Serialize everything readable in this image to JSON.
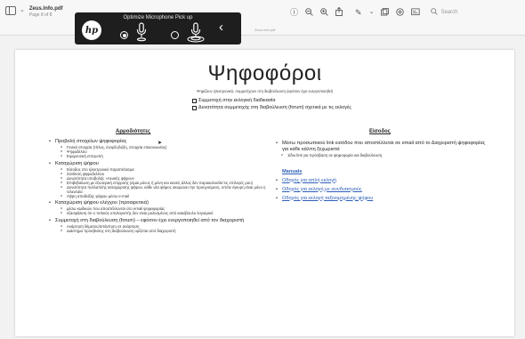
{
  "toolbar": {
    "doc_title": "Zeus.Info.pdf",
    "page_indicator": "Page 8 of 8",
    "search_placeholder": "Search"
  },
  "hp_overlay": {
    "title": "Optimize Microphone Pick up",
    "logo": "hp",
    "hidden_label": "Zeus.Info.pdf"
  },
  "icons": {
    "sidebar": "sidebar-toggle-icon",
    "info": "info-icon",
    "zoom_out": "zoom-out-icon",
    "zoom_in": "zoom-in-icon",
    "share": "share-icon",
    "markup": "markup-icon",
    "window": "window-icon",
    "annotate": "annotate-icon",
    "form": "form-icon",
    "search": "search-icon"
  },
  "page": {
    "title": "Ψηφοφόροι",
    "subtitle": "Ψηφίζουν ηλεκτρονικά, συμμετέχουν στη διαβούλευση (εφόσον έχει ενεργοποιηθεί)",
    "options": [
      "Συμμετοχή στην εκλογική διαδικασία",
      "Δυνατότητα συμμετοχής στη διαβούλευση (forum) σχετικά με τις εκλογές"
    ],
    "left_heading": "Αρμοδιότητες",
    "left_items": [
      {
        "text": "Προβολή στοιχείων ψηφοφορίας",
        "subs": [
          "Γενικά στοιχεία (τίτλος, έναρξη/λήξη, στοιχεία επικοινωνίας)",
          "Ψηφοδέλτιο",
          "Εφορευτική επιτροπή"
        ]
      },
      {
        "text": "Καταχώριση ψήφου",
        "subs": [
          "Είσοδος στο ηλεκτρονικό παραπέτασμα",
          "Σύνθεση ψηφοδελτίου",
          "Δυνατότητα υποβολής «Λευκής ψήφου»",
          "Επιβεβαίωση με εξωτερική επιρροής (είμαι μόνος ή μόνη και κανείς άλλος δεν παρακολουθεί τις επιλογές μου)",
          "Δυνατότητα πολλαπλής καταχώρισης ψήφου, κάθε νέα ψήφος ακυρώνει την προηγούμενη, οπότε έγκυρη είναι μόνο η τελευταία",
          "Λήψη αποδείξης ψήφου μέσω e-mail"
        ]
      },
      {
        "text": "Καταχώριση ψήφου ελέγχου (προαιρετικά)",
        "subs": [
          "μέσω κωδικών που αποστέλλονται στο email ψηφοφορίας",
          "εξασφάλιση ότι ο τοπικός υπολογιστής δεν είναι μολυσμένος από κακόβουλο λογισμικό"
        ]
      },
      {
        "text": "Συμμετοχή στη διαβούλευση (forum) – εφόσον έχει ενεργοποιηθεί από τον διαχειριστή",
        "subs": [
          "Ανάρτηση θέματος/απάντηση σε ανάρτηση",
          "Διάστημα πρόσβασης στη διαβούλευση ορίζεται από διαχειριστή"
        ]
      }
    ],
    "right_heading": "Είσοδος",
    "right_item": "Μέσω προσωπικού link εισόδου που αποστέλλεται σε email από το Διαχειριστή ψηφοφορίας για κάθε κάλπη ξεχωριστά",
    "right_sub": "1ίδιο link για πρόσβαση σε ψηφοφορία και διαβούλευση",
    "manuals_heading": "Manuals",
    "manual_links": [
      "Οδηγός για απλή εκλογή",
      "Οδηγός για εκλογή με συνδυασμούς",
      "Οδηγός για εκλογή ταξινομημένης ψήφου"
    ]
  }
}
